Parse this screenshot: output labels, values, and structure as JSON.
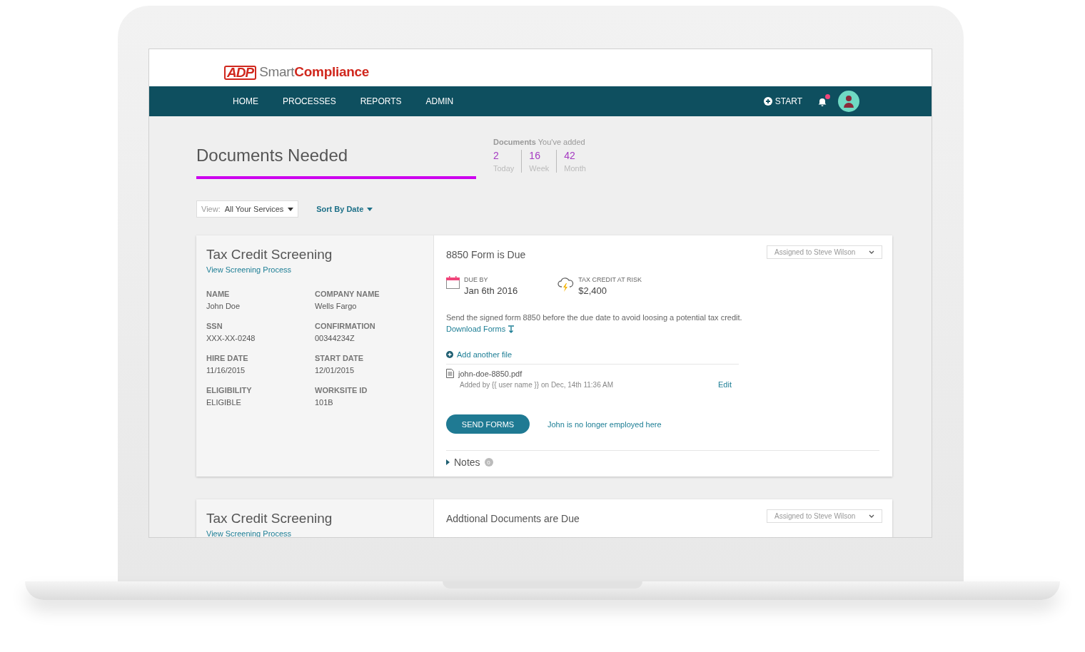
{
  "header": {
    "logo": {
      "mark": "ADP",
      "name": "Smart**Compliance**"
    },
    "nav": [
      {
        "label": "HOME"
      },
      {
        "label": "PROCESSES"
      },
      {
        "label": "REPORTS"
      },
      {
        "label": "ADMIN"
      }
    ],
    "start": "START",
    "notifications": {
      "unread": true
    }
  },
  "page": {
    "title": "Documents Needed",
    "stats": {
      "label": "**Documents** You've added",
      "items": [
        {
          "value": "2",
          "label": "Today"
        },
        {
          "value": "16",
          "label": "Week"
        },
        {
          "value": "42",
          "label": "Month"
        }
      ]
    },
    "filters": {
      "view_label": "View:",
      "view_value": "All Your Services",
      "sort": "Sort By Date"
    }
  },
  "cards": [
    {
      "title": "Tax Credit Screening",
      "link": "View Screening Process",
      "fields": [
        {
          "label": "NAME",
          "value": "John Doe"
        },
        {
          "label": "COMPANY NAME",
          "value": "Wells Fargo"
        },
        {
          "label": "SSN",
          "value": "XXX-XX-0248"
        },
        {
          "label": "CONFIRMATION",
          "value": "00344234Z"
        },
        {
          "label": "HIRE DATE",
          "value": "11/16/2015"
        },
        {
          "label": "START DATE",
          "value": "12/01/2015"
        },
        {
          "label": "ELIGIBILITY",
          "value": "ELIGIBLE"
        },
        {
          "label": "WORKSITE ID",
          "value": "101B"
        }
      ],
      "task": {
        "title": "8850 Form is Due",
        "assigned": "Assigned to Steve Wilson",
        "due_label": "DUE BY",
        "due": "Jan 6th 2016",
        "risk_label": "TAX CREDIT AT RISK",
        "risk": "$2,400",
        "message": "Send the signed form 8850 before the due date to avoid loosing a potential tax credit.",
        "download": "Download Forms",
        "add_file": "Add another file",
        "files": [
          {
            "name": "john-doe-8850.pdf",
            "meta": "Added by {{ user name }} on Dec, 14th 11:36 AM",
            "action": "Edit"
          }
        ],
        "send": "SEND FORMS",
        "secondary": "John is no longer employed here",
        "notes_label": "Notes",
        "notes_count": "0",
        "notes_expanded": false
      }
    },
    {
      "title": "Tax Credit Screening",
      "link": "View Screening Process",
      "task": {
        "title": "Addtional Documents are Due",
        "assigned": "Assigned to Steve Wilson"
      }
    }
  ]
}
